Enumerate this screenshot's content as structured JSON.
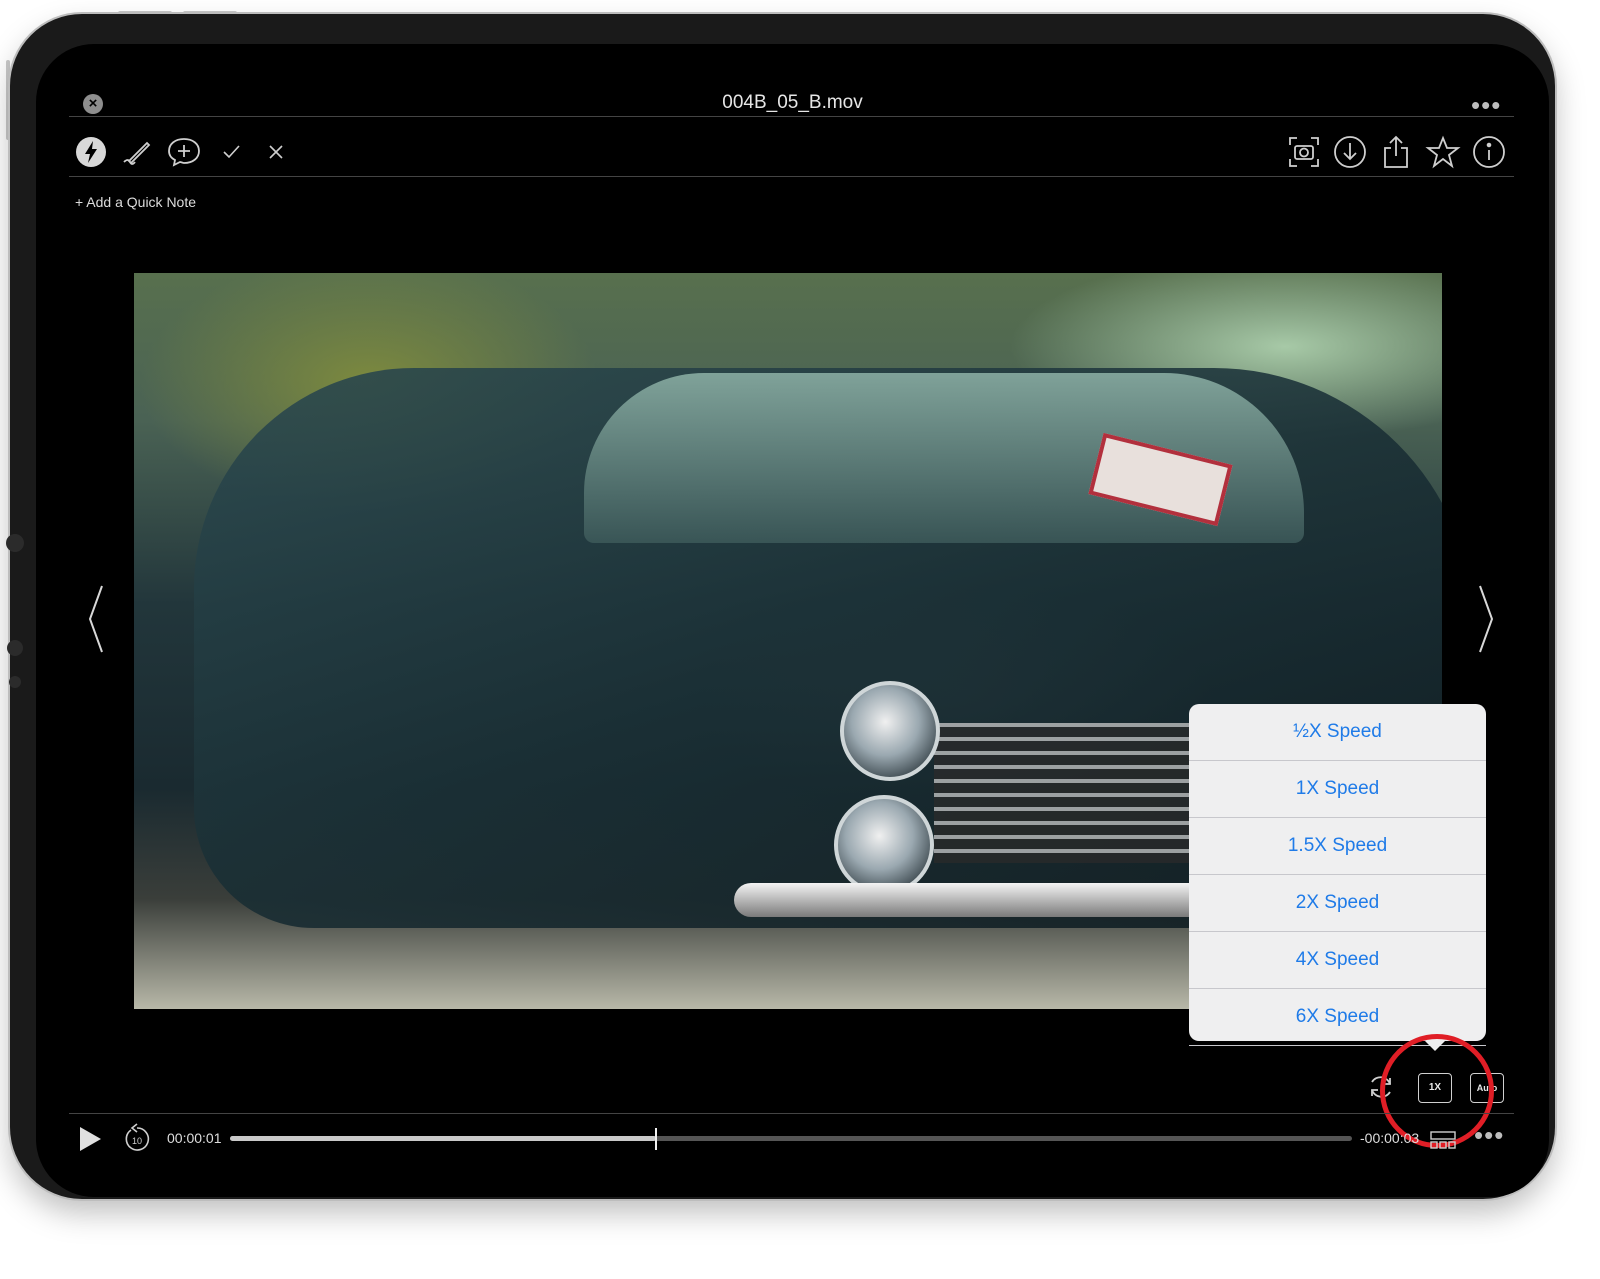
{
  "header": {
    "title": "004B_05_B.mov",
    "close_icon": "close-icon",
    "more_icon": "more-icon"
  },
  "toolbar": {
    "left_icons": [
      "lightning-icon",
      "pencil-icon",
      "comment-add-icon",
      "checkmark-icon",
      "x-icon"
    ],
    "right_icons": [
      "screenshot-icon",
      "download-icon",
      "share-icon",
      "star-icon",
      "info-icon"
    ]
  },
  "quick_note": {
    "label": "+ Add a Quick Note"
  },
  "speed_menu": {
    "items": [
      "½X Speed",
      "1X Speed",
      "1.5X Speed",
      "2X Speed",
      "4X Speed",
      "6X Speed"
    ],
    "accent_color": "#1f7be8"
  },
  "controls": {
    "speed_button_label": "1X",
    "quality_button_label": "Auto",
    "current_time": "00:00:01",
    "remaining_time": "-00:00:03",
    "progress": 0.38,
    "highlight_color": "#e01e26"
  }
}
